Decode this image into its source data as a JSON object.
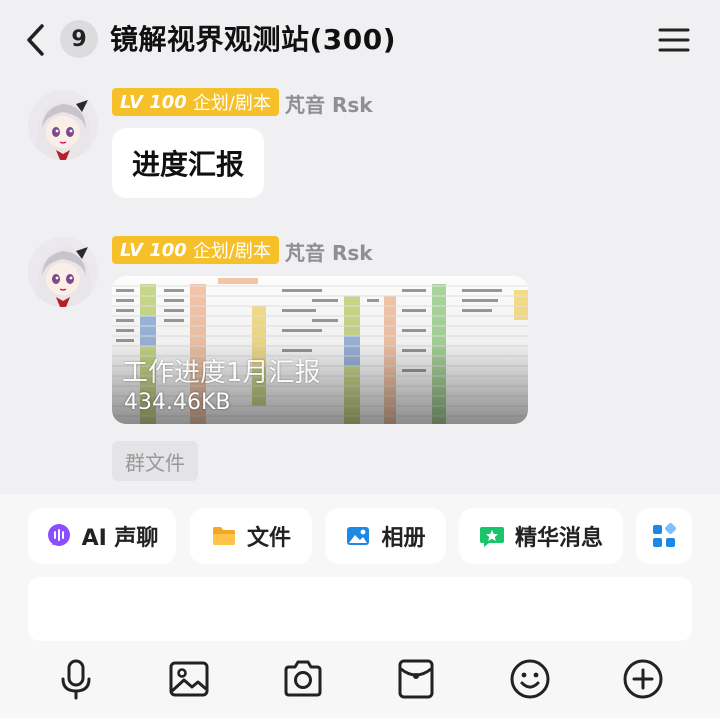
{
  "header": {
    "unread_count": "9",
    "title": "镜解视界观测站(300)"
  },
  "messages": [
    {
      "level": "LV 100",
      "role": "企划/剧本",
      "sender": "芃音 Rsk",
      "text": "进度汇报"
    },
    {
      "level": "LV 100",
      "role": "企划/剧本",
      "sender": "芃音 Rsk",
      "file_name": "工作进度1月汇报",
      "file_size": "434.46KB",
      "file_tag": "群文件"
    }
  ],
  "quick_actions": [
    {
      "label": "AI 声聊",
      "icon": "ai-voice-icon",
      "color": "#8a4dff"
    },
    {
      "label": "文件",
      "icon": "folder-icon",
      "color": "#f5a623"
    },
    {
      "label": "相册",
      "icon": "album-icon",
      "color": "#1e88e5"
    },
    {
      "label": "精华消息",
      "icon": "essence-icon",
      "color": "#19c46b"
    }
  ],
  "toolbar": [
    "microphone-icon",
    "image-icon",
    "camera-icon",
    "red-packet-icon",
    "emoji-icon",
    "plus-icon"
  ]
}
